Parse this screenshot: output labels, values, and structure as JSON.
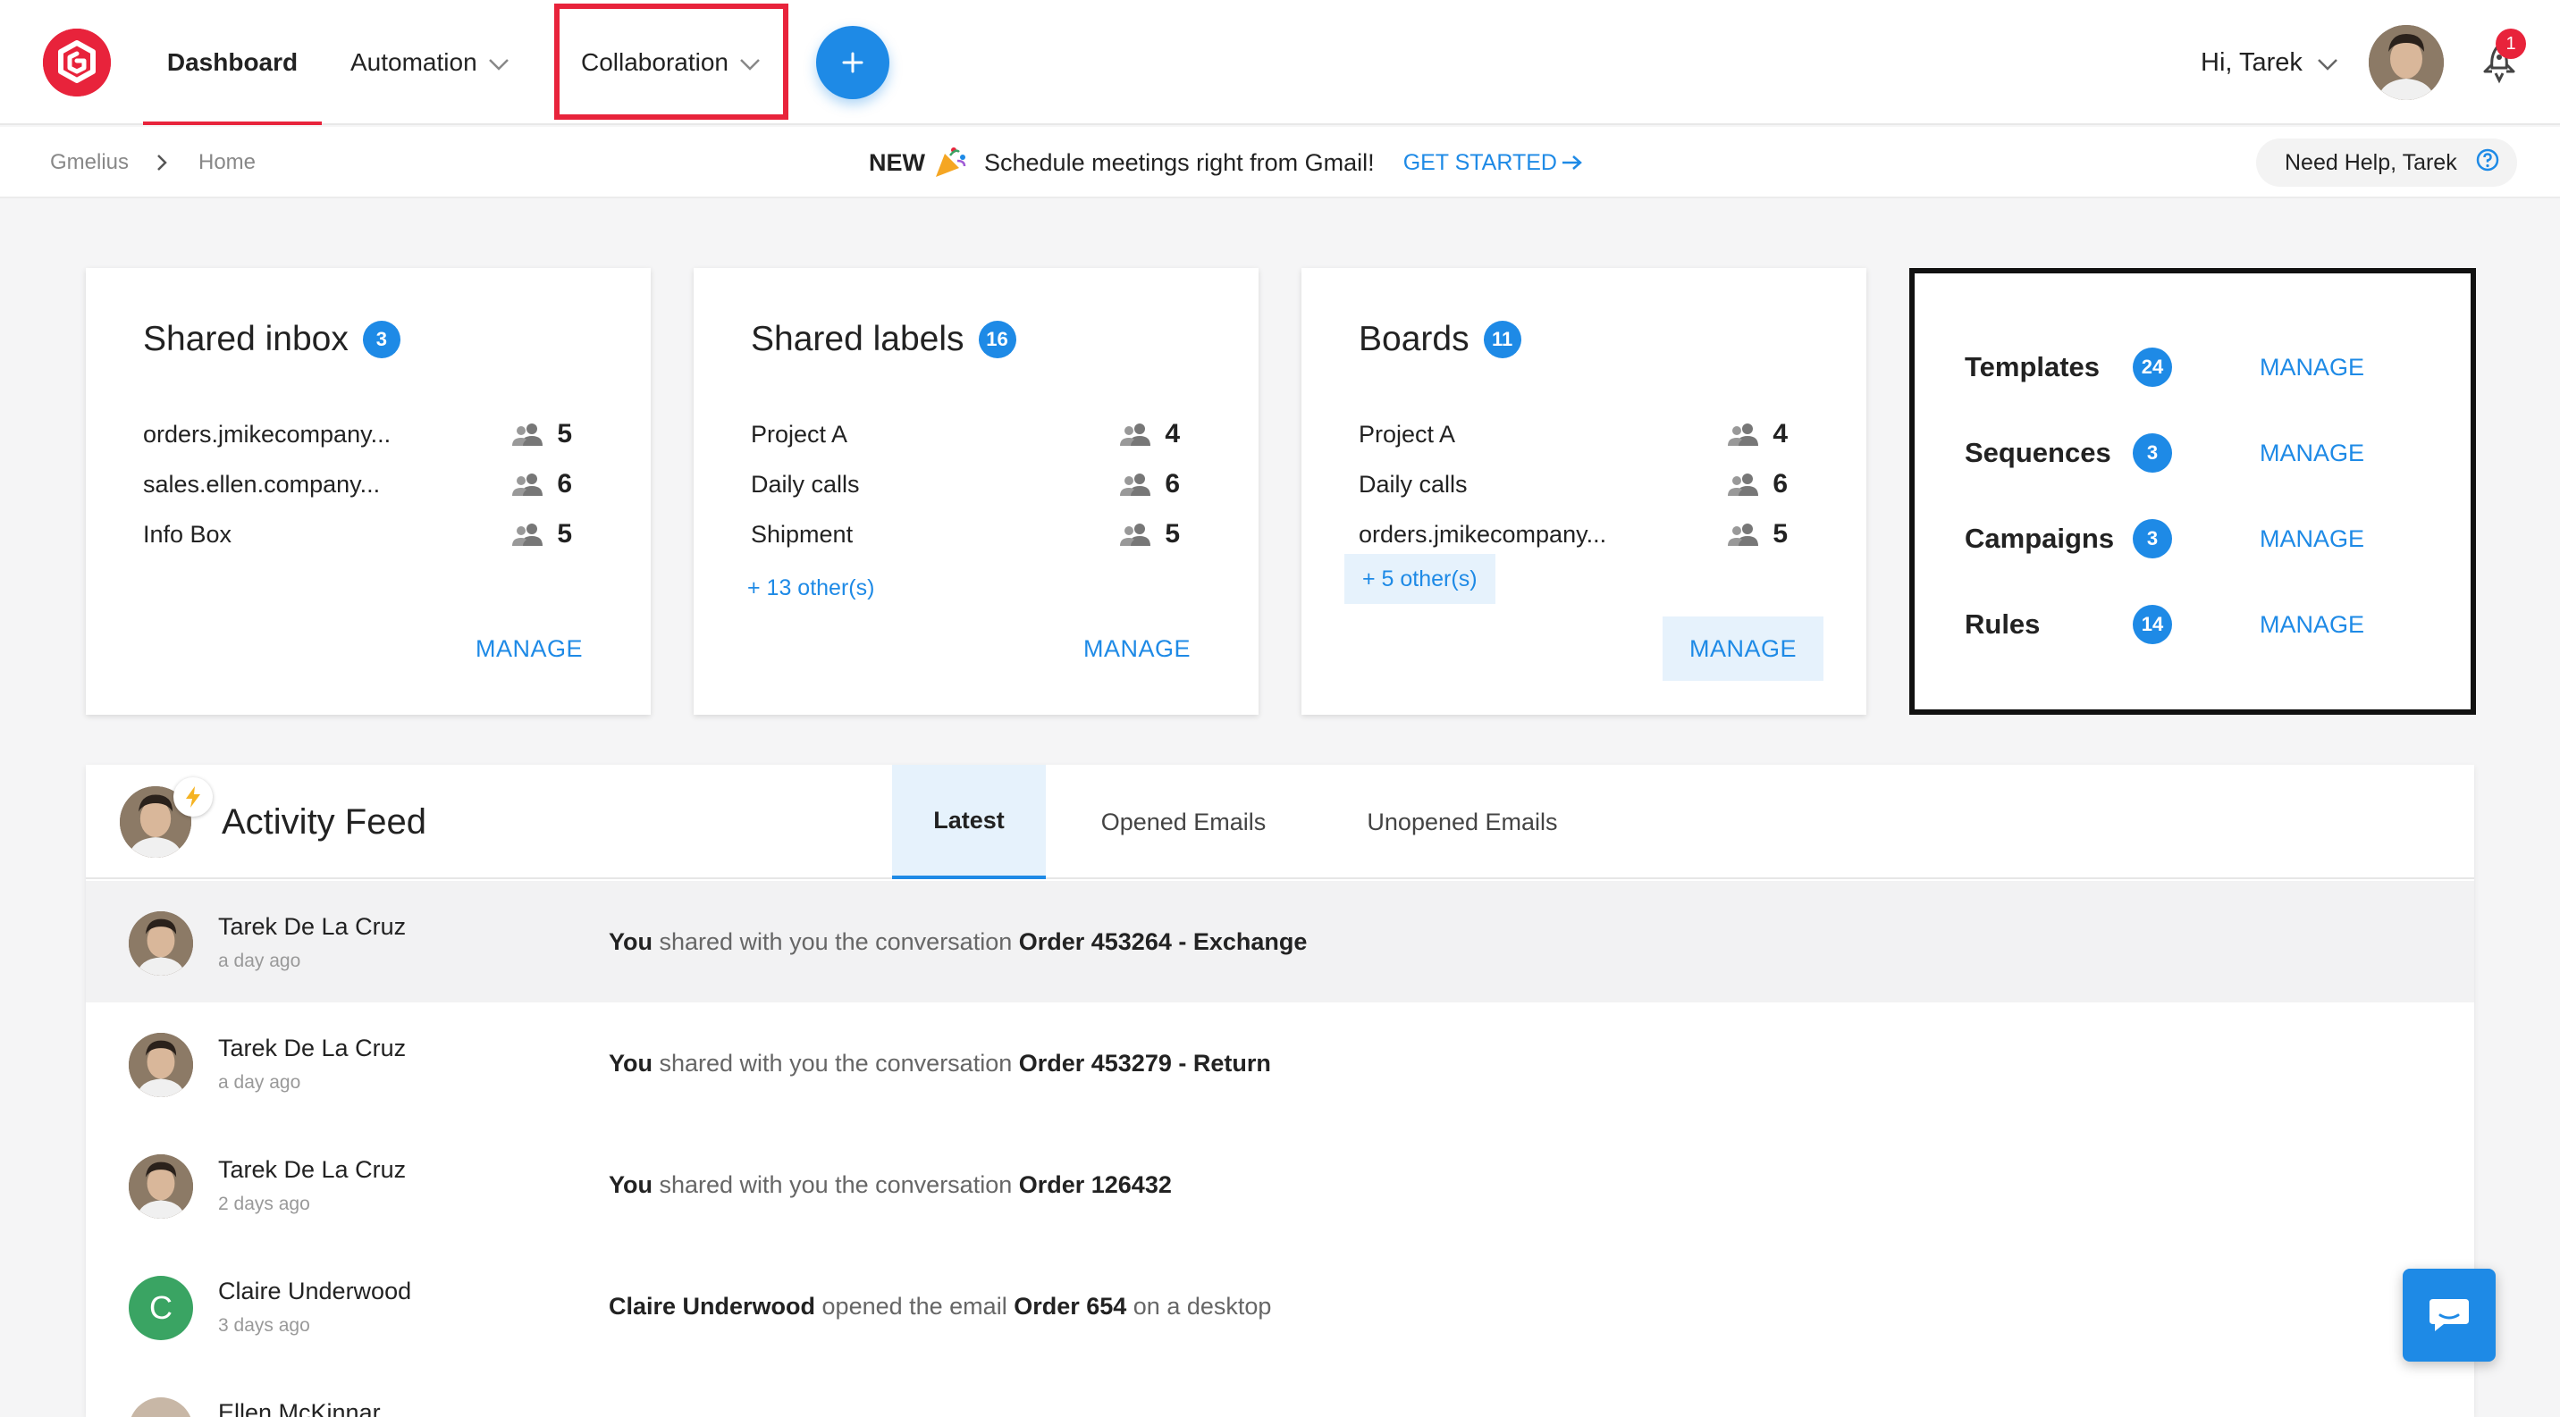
{
  "nav": {
    "dashboard": "Dashboard",
    "automation": "Automation",
    "collaboration": "Collaboration",
    "greeting": "Hi, Tarek",
    "notification_count": "1"
  },
  "breadcrumb": {
    "root": "Gmelius",
    "current": "Home"
  },
  "promo": {
    "new_label": "NEW",
    "message": "Schedule meetings right from Gmail!",
    "cta": "GET STARTED"
  },
  "help": {
    "label": "Need Help, Tarek"
  },
  "cards": {
    "shared_inbox": {
      "title": "Shared inbox",
      "count": "3",
      "rows": [
        {
          "name": "orders.jmikecompany...",
          "members": "5"
        },
        {
          "name": "sales.ellen.company...",
          "members": "6"
        },
        {
          "name": "Info Box",
          "members": "5"
        }
      ],
      "manage": "MANAGE"
    },
    "shared_labels": {
      "title": "Shared labels",
      "count": "16",
      "rows": [
        {
          "name": "Project A",
          "members": "4"
        },
        {
          "name": "Daily calls",
          "members": "6"
        },
        {
          "name": "Shipment",
          "members": "5"
        }
      ],
      "others": "+ 13 other(s)",
      "manage": "MANAGE"
    },
    "boards": {
      "title": "Boards",
      "count": "11",
      "rows": [
        {
          "name": "Project A",
          "members": "4"
        },
        {
          "name": "Daily calls",
          "members": "6"
        },
        {
          "name": "orders.jmikecompany...",
          "members": "5"
        }
      ],
      "others": "+ 5 other(s)",
      "manage": "MANAGE"
    }
  },
  "tools": [
    {
      "name": "Templates",
      "count": "24",
      "action": "MANAGE"
    },
    {
      "name": "Sequences",
      "count": "3",
      "action": "MANAGE"
    },
    {
      "name": "Campaigns",
      "count": "3",
      "action": "MANAGE"
    },
    {
      "name": "Rules",
      "count": "14",
      "action": "MANAGE"
    }
  ],
  "feed": {
    "title": "Activity Feed",
    "tabs": [
      "Latest",
      "Opened Emails",
      "Unopened Emails"
    ],
    "items": [
      {
        "name": "Tarek De La Cruz",
        "time": "a day ago",
        "actor": "You",
        "verb": " shared with you the conversation ",
        "subject": "Order 453264 - Exchange",
        "suffix": ""
      },
      {
        "name": "Tarek De La Cruz",
        "time": "a day ago",
        "actor": "You",
        "verb": " shared with you the conversation ",
        "subject": "Order 453279 - Return",
        "suffix": ""
      },
      {
        "name": "Tarek De La Cruz",
        "time": "2 days ago",
        "actor": "You",
        "verb": " shared with you the conversation ",
        "subject": "Order 126432",
        "suffix": ""
      },
      {
        "name": "Claire Underwood",
        "initial": "C",
        "time": "3 days ago",
        "actor": "Claire Underwood",
        "verb": " opened the email ",
        "subject": "Order 654",
        "suffix": " on a desktop"
      },
      {
        "name": "Ellen McKinnar"
      }
    ]
  },
  "colors": {
    "brand": "#e8233b",
    "accent": "#1e8ae6"
  }
}
